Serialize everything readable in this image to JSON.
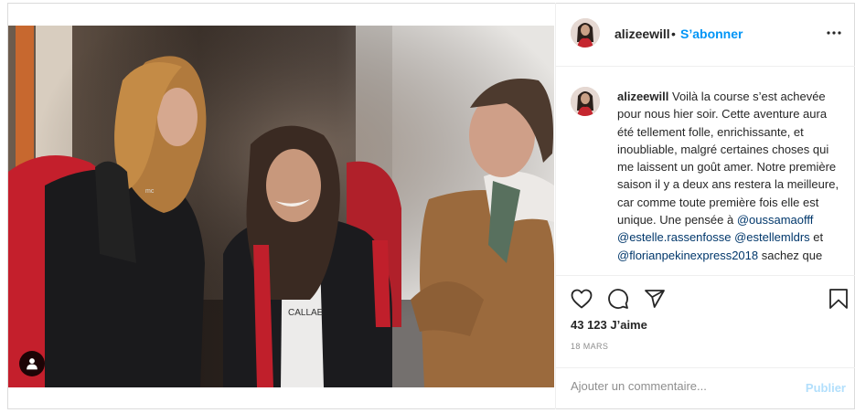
{
  "post": {
    "username": "alizeewill",
    "separator": "•",
    "follow_label": "S’abonner",
    "more_icon": "more-horizontal-icon",
    "caption": {
      "username": "alizeewill",
      "text_1": "Voilà la course s’est achevée pour nous hier soir. Cette aventure aura été tellement folle, enrichissante, et inoubliable, malgré certaines choses qui me laissent un goût amer. Notre première saison il y a deux ans restera la meilleure, car comme toute première fois elle est unique. Une pensée à ",
      "mention_1": "@oussamaofff",
      "space_1": " ",
      "mention_2": "@estelle.rassenfosse",
      "space_2": " ",
      "mention_3": "@estellemldrs",
      "text_2": " et ",
      "mention_4": "@florianpekinexpress2018",
      "text_3": " sachez que"
    },
    "actions": {
      "like_icon": "heart-icon",
      "comment_icon": "comment-icon",
      "share_icon": "share-icon",
      "save_icon": "bookmark-icon"
    },
    "likes": "43 123 J’aime",
    "date": "18 MARS",
    "comment": {
      "placeholder": "Ajouter un commentaire...",
      "value": "",
      "publish_label": "Publier"
    },
    "photo": {
      "tag_icon": "user-tag-icon",
      "shirt_text": "CALLAE"
    },
    "colors": {
      "accent": "#0095f6",
      "mention": "#00376b",
      "publish_disabled": "#b2dffc",
      "muted": "#8e8e8e"
    }
  }
}
